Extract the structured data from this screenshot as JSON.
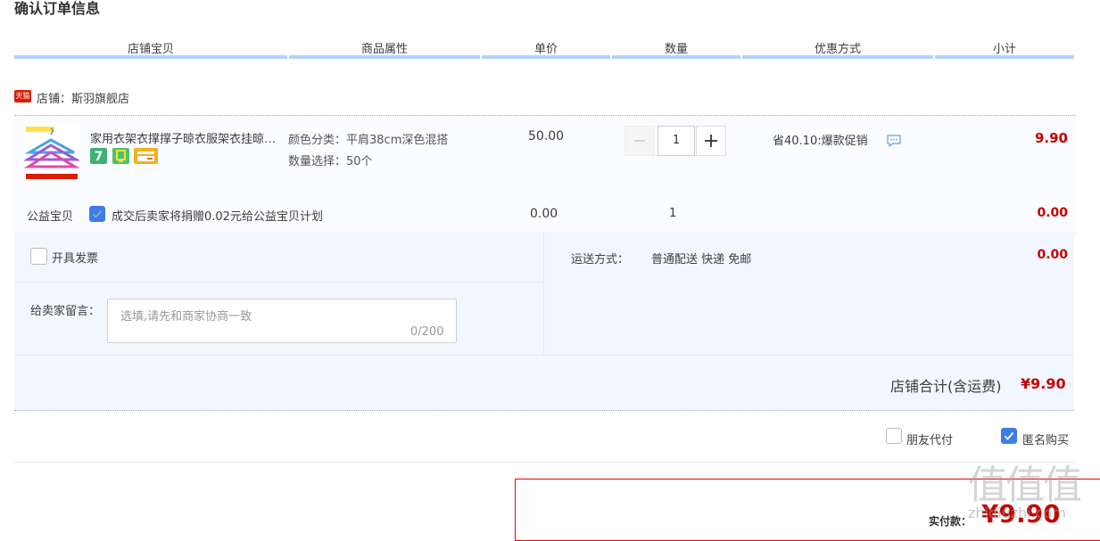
{
  "page_title": "确认订单信息",
  "columns": [
    "店铺宝贝",
    "商品属性",
    "单价",
    "数量",
    "优惠方式",
    "小计"
  ],
  "shop": {
    "icon_text": "天猫",
    "label": "店铺：斯羽旗舰店"
  },
  "item": {
    "title": "家用衣架衣撑撑子晾衣服架衣挂晾衣架防滑无痕",
    "attr_color": "颜色分类：平肩38cm深色混搭",
    "attr_qty": "数量选择：50个",
    "price": "50.00",
    "quantity": "1",
    "promo": "省40.10:爆款促销",
    "subtotal": "9.90"
  },
  "charity": {
    "label": "公益宝贝",
    "desc": "成交后卖家将捐赠0.02元给公益宝贝计划",
    "price": "0.00",
    "quantity": "1",
    "subtotal": "0.00"
  },
  "invoice": {
    "label": "开具发票"
  },
  "shipping": {
    "label": "运送方式：",
    "value": "普通配送 快递 免邮",
    "cost": "0.00"
  },
  "message": {
    "label": "给卖家留言：",
    "placeholder": "选填,请先和商家协商一致",
    "count": "0/200"
  },
  "shop_total": {
    "label": "店铺合计(含运费)",
    "value": "¥9.90"
  },
  "options": {
    "friend_pay": "朋友代付",
    "anonymous": "匿名购买"
  },
  "payment": {
    "label": "实付款：",
    "value": "¥9.90"
  },
  "watermark": {
    "text": "值值值",
    "sub": "zhidiuzhi.com"
  },
  "colors": {
    "accent": "#c40000",
    "header_line": "#b2d1ff",
    "checkbox_blue": "#3d7dea"
  }
}
